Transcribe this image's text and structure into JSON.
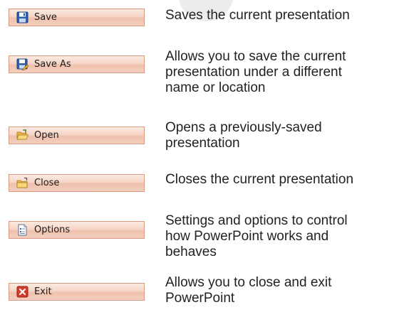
{
  "items": [
    {
      "label": "Save",
      "icon": "floppy-disk-icon",
      "description": "Saves the current presentation"
    },
    {
      "label": "Save As",
      "icon": "save-as-icon",
      "description": "Allows you to save the current\npresentation under a different\nname or location"
    },
    {
      "label": "Open",
      "icon": "open-folder-icon",
      "description": "Opens a previously-saved\npresentation"
    },
    {
      "label": "Close",
      "icon": "close-folder-icon",
      "description": "Closes the current presentation"
    },
    {
      "label": "Options",
      "icon": "options-document-icon",
      "description": "Settings and options to control\nhow PowerPoint works and\nbehaves"
    },
    {
      "label": "Exit",
      "icon": "exit-x-icon",
      "description": "Allows you to close and exit\nPowerPoint"
    }
  ]
}
